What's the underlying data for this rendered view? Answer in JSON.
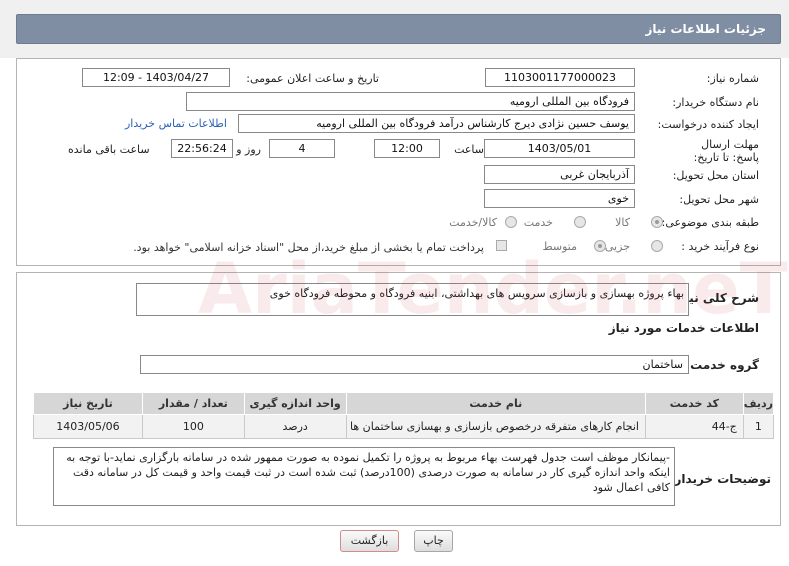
{
  "header": {
    "title": "جزئیات اطلاعات نیاز"
  },
  "fields": {
    "need_number_label": "شماره نیاز:",
    "need_number": "1103001177000023",
    "announce_datetime_label": "تاریخ و ساعت اعلان عمومی:",
    "announce_datetime": "1403/04/27 - 12:09",
    "buyer_org_label": "نام دستگاه خریدار:",
    "buyer_org": "فرودگاه بین المللی ارومیه",
    "requester_label": "ایجاد کننده درخواست:",
    "requester": "یوسف حسین نژادی دیرج کارشناس درآمد فرودگاه بین المللی ارومیه",
    "contact_link": "اطلاعات تماس خریدار",
    "deadline_label": "مهلت ارسال پاسخ: تا تاریخ:",
    "deadline_date": "1403/05/01",
    "hour_label": "ساعت",
    "deadline_hour": "12:00",
    "days_value": "4",
    "days_label": "روز و",
    "remaining_time": "22:56:24",
    "remaining_label": "ساعت باقی مانده",
    "province_label": "استان محل تحویل:",
    "province": "آذربایجان غربی",
    "city_label": "شهر محل تحویل:",
    "city": "خوی",
    "category_label": "طبقه بندی موضوعی:",
    "category_options": [
      "کالا",
      "خدمت",
      "کالا/خدمت"
    ],
    "process_label": "نوع فرآیند خرید :",
    "process_options": [
      "جزیی",
      "متوسط"
    ],
    "payment_note": "پرداخت تمام یا بخشی از مبلغ خرید،از محل \"اسناد خزانه اسلامی\" خواهد بود."
  },
  "summary": {
    "label": "شرح کلی نیاز:",
    "text": "بهاء پروژه بهسازی و بازسازی سرویس های بهداشتی، ابنیه فرودگاه و محوطه فرودگاه خوی"
  },
  "services": {
    "section_title": "اطلاعات خدمات مورد نیاز",
    "group_label": "گروه خدمت:",
    "group_value": "ساختمان",
    "columns": [
      "ردیف",
      "کد خدمت",
      "نام خدمت",
      "واحد اندازه گیری",
      "تعداد / مقدار",
      "تاریخ نیاز"
    ],
    "rows": [
      [
        "1",
        "ج-44",
        "انجام کارهای متفرقه درخصوص بازسازی و بهسازی ساختمان ها",
        "درصد",
        "100",
        "1403/05/06"
      ]
    ]
  },
  "buyer_notes": {
    "label": "توضیحات خریدار:",
    "text": "-پیمانکار موظف است جدول فهرست بهاء مربوط به پروژه را تکمیل نموده به صورت ممهور شده در سامانه بارگزاری نماید-با توجه به اینکه واحد اندازه گیری کار در سامانه به صورت درصدی (100درصد) ثبت شده است در ثبت قیمت واحد و قیمت کل در سامانه دقت کافی اعمال شود"
  },
  "buttons": {
    "print": "چاپ",
    "back": "بازگشت"
  },
  "watermark": "AriaTender.neT"
}
